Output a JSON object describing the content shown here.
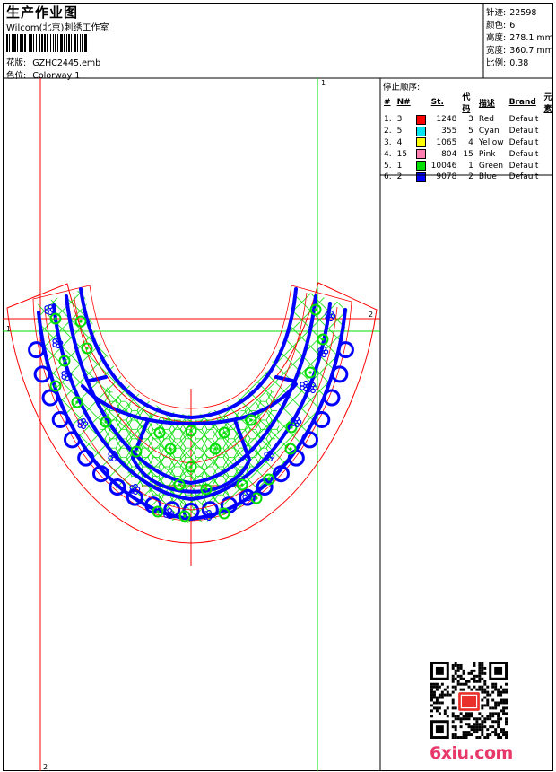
{
  "header": {
    "title": "生产作业图",
    "company": "Wilcom(北京)刺绣工作室",
    "file_label": "花版:",
    "file_name": "GZHC2445.emb",
    "colorway_label": "色位:",
    "colorway_name": "Colorway 1"
  },
  "stats": [
    {
      "label": "针迹:",
      "value": "22598"
    },
    {
      "label": "颜色:",
      "value": "6"
    },
    {
      "label": "高度:",
      "value": "278.1 mm"
    },
    {
      "label": "宽度:",
      "value": "360.7 mm"
    },
    {
      "label": "比例:",
      "value": "0.38"
    }
  ],
  "stop_sequence": {
    "title": "停止顺序:",
    "columns": [
      "#",
      "N#",
      "St.",
      "代码",
      "描述",
      "Brand",
      "元素"
    ],
    "rows": [
      {
        "seq": "1.",
        "n": "3",
        "color": "#ff0000",
        "st": "1248",
        "code": "3",
        "desc": "Red",
        "brand": "Default"
      },
      {
        "seq": "2.",
        "n": "5",
        "color": "#00e5ee",
        "st": "355",
        "code": "5",
        "desc": "Cyan",
        "brand": "Default"
      },
      {
        "seq": "3.",
        "n": "4",
        "color": "#ffff00",
        "st": "1065",
        "code": "4",
        "desc": "Yellow",
        "brand": "Default"
      },
      {
        "seq": "4.",
        "n": "15",
        "color": "#ff80b0",
        "st": "804",
        "code": "15",
        "desc": "Pink",
        "brand": "Default"
      },
      {
        "seq": "5.",
        "n": "1",
        "color": "#00dd00",
        "st": "10046",
        "code": "1",
        "desc": "Green",
        "brand": "Default"
      },
      {
        "seq": "6.",
        "n": "2",
        "color": "#0000ff",
        "st": "9078",
        "code": "2",
        "desc": "Blue",
        "brand": "Default"
      }
    ]
  },
  "guides": {
    "v_red": "2",
    "v_green": "1",
    "h_red": "2",
    "h_green": "1"
  },
  "watermark": "6xiu.com",
  "colors": {
    "red": "#ff0000",
    "green": "#00dd00",
    "blue": "#0000ff"
  }
}
